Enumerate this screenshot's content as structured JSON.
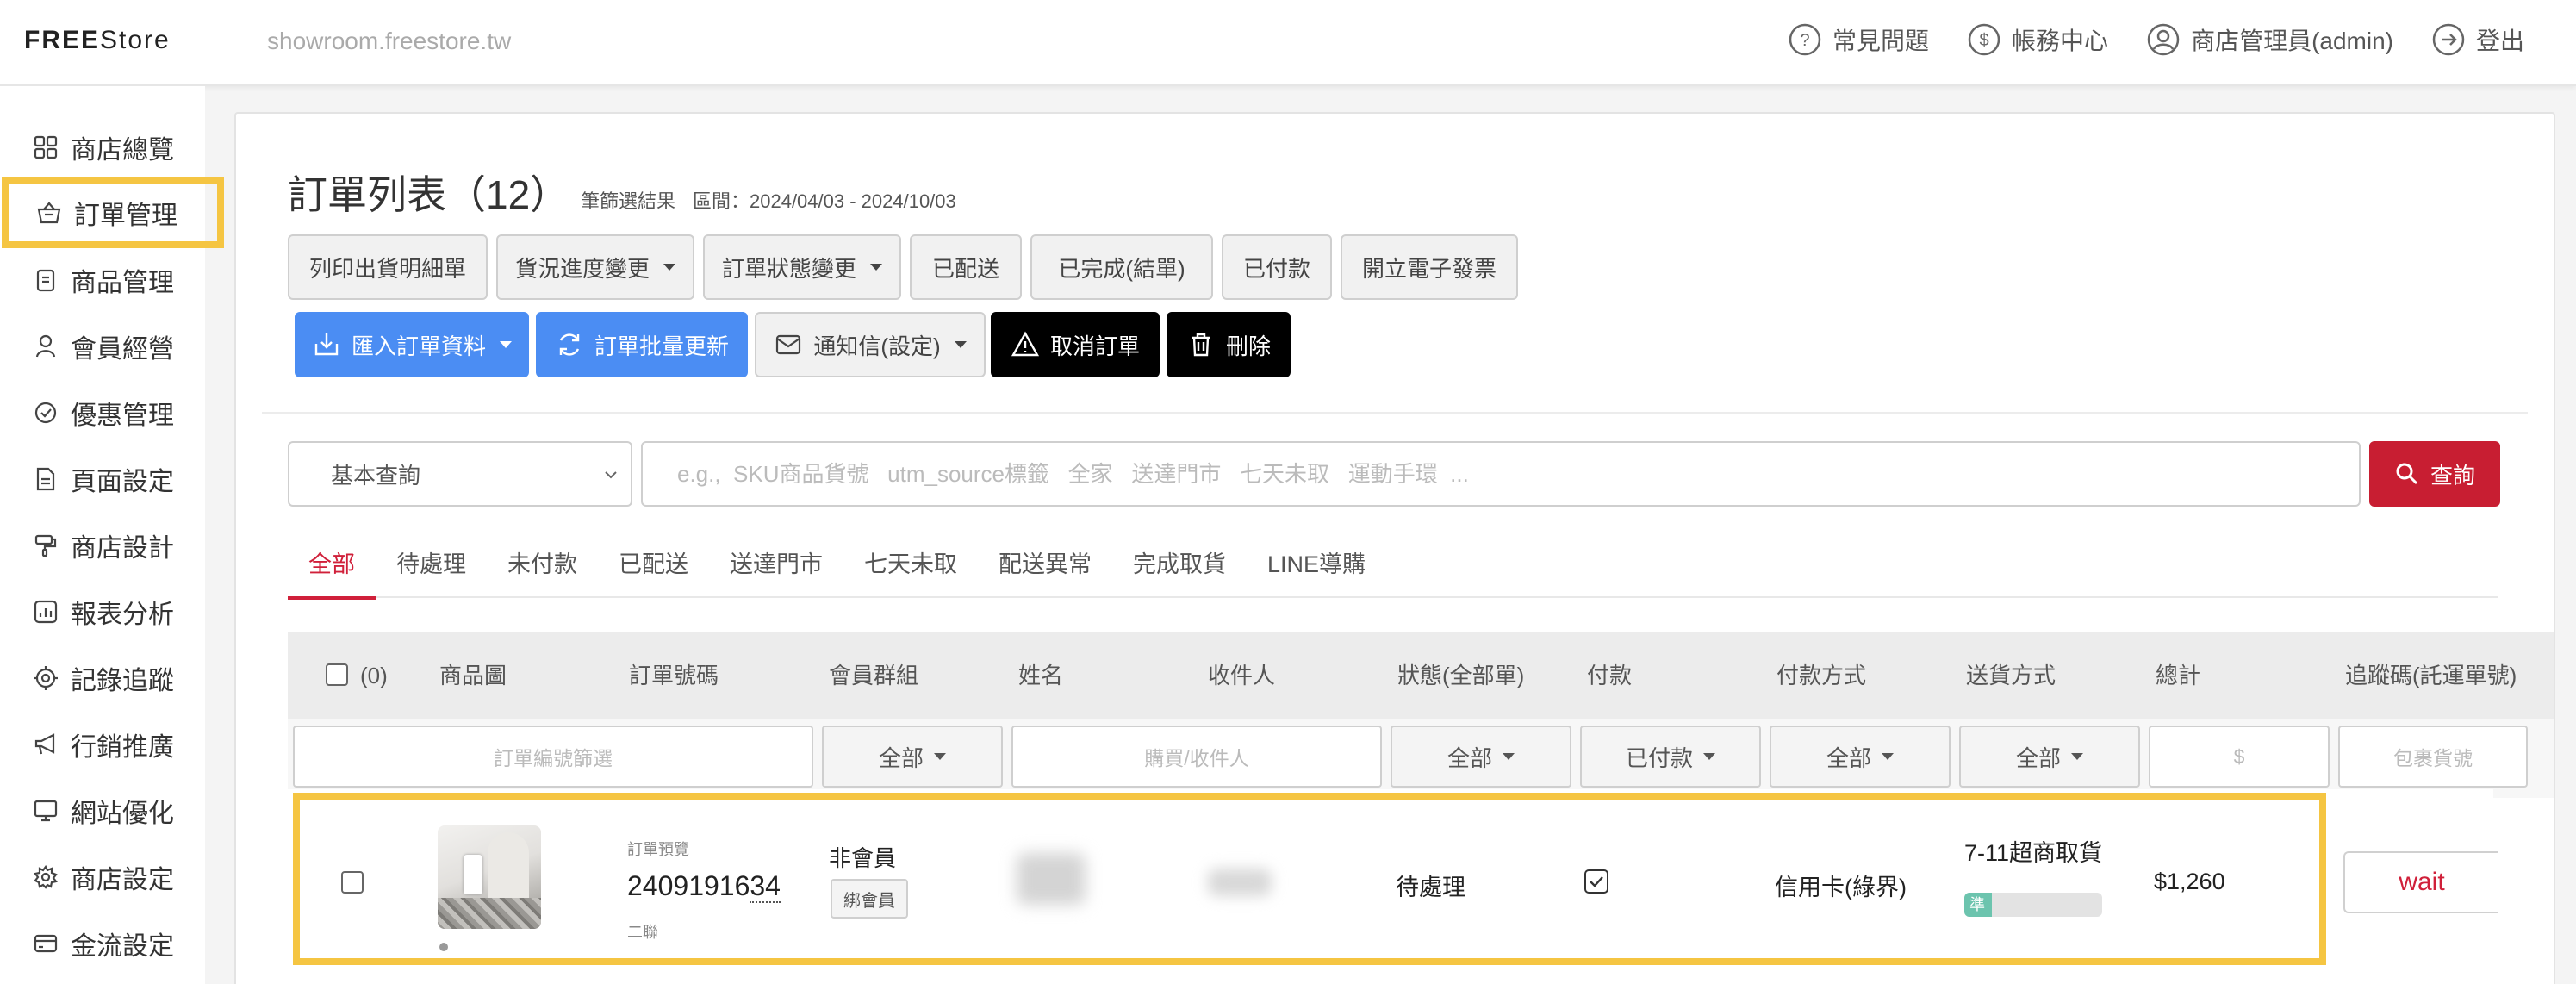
{
  "header": {
    "logo_prefix": "FREE",
    "logo_suffix": "Store",
    "domain": "showroom.freestore.tw",
    "links": {
      "faq": "常見問題",
      "billing": "帳務中心",
      "admin": "商店管理員(admin)",
      "logout": "登出"
    }
  },
  "sidebar": {
    "items": [
      {
        "label": "商店總覽",
        "icon": "grid-icon"
      },
      {
        "label": "訂單管理",
        "icon": "basket-icon",
        "active": true
      },
      {
        "label": "商品管理",
        "icon": "clipboard-icon"
      },
      {
        "label": "會員經營",
        "icon": "user-icon"
      },
      {
        "label": "優惠管理",
        "icon": "badge-icon"
      },
      {
        "label": "頁面設定",
        "icon": "page-icon"
      },
      {
        "label": "商店設計",
        "icon": "brush-icon"
      },
      {
        "label": "報表分析",
        "icon": "chart-icon"
      },
      {
        "label": "記錄追蹤",
        "icon": "target-icon"
      },
      {
        "label": "行銷推廣",
        "icon": "megaphone-icon"
      },
      {
        "label": "網站優化",
        "icon": "monitor-icon"
      },
      {
        "label": "商店設定",
        "icon": "gear-icon"
      },
      {
        "label": "金流設定",
        "icon": "card-icon"
      }
    ]
  },
  "page": {
    "title": "訂單列表（12）",
    "filter_result": "筆篩選結果",
    "range": "區間：2024/04/03 - 2024/10/03"
  },
  "toolbar": {
    "print": "列印出貨明細單",
    "shipping_progress": "貨況進度變更",
    "order_status": "訂單狀態變更",
    "shipped": "已配送",
    "completed": "已完成(結單)",
    "paid": "已付款",
    "invoice": "開立電子發票",
    "import": "匯入訂單資料",
    "batch_update": "訂單批量更新",
    "notify": "通知信(設定)",
    "cancel": "取消訂單",
    "delete": "刪除"
  },
  "search": {
    "mode": "基本查詢",
    "placeholder": "e.g.,  SKU商品貨號   utm_source標籤   全家   送達門市   七天未取   運動手環  ...",
    "button": "查詢"
  },
  "tabs": [
    "全部",
    "待處理",
    "未付款",
    "已配送",
    "送達門市",
    "七天未取",
    "配送異常",
    "完成取貨",
    "LINE導購"
  ],
  "table": {
    "selected_count": "(0)",
    "columns": [
      "商品圖",
      "訂單號碼",
      "會員群組",
      "姓名",
      "收件人",
      "狀態(全部單)",
      "付款",
      "付款方式",
      "送貨方式",
      "總計",
      "追蹤碼(託運單號)"
    ],
    "filters": {
      "order_no_placeholder": "訂單編號篩選",
      "member_group": "全部",
      "buyer_placeholder": "購買/收件人",
      "status": "全部",
      "payment": "已付款",
      "payment_method": "全部",
      "shipping": "全部",
      "total_placeholder": "$",
      "tracking_placeholder": "包裹貨號"
    },
    "rows": [
      {
        "preorder_tag": "訂單預覽",
        "order_no_main": "24091916",
        "order_no_tail": "34",
        "order_sub": "二聯",
        "member_group": "非會員",
        "bind_member": "綁會員",
        "status": "待處理",
        "paid": true,
        "payment_method": "信用卡(綠界)",
        "shipping": "7-11超商取貨",
        "shipping_progress_label": "準",
        "shipping_progress": 0.2,
        "total": "$1,260",
        "tracking": "wait"
      }
    ]
  },
  "colors": {
    "highlight": "#f5c542",
    "primary_blue": "#4b8df3",
    "danger_red": "#c81e32",
    "tab_active": "#d0203a"
  }
}
